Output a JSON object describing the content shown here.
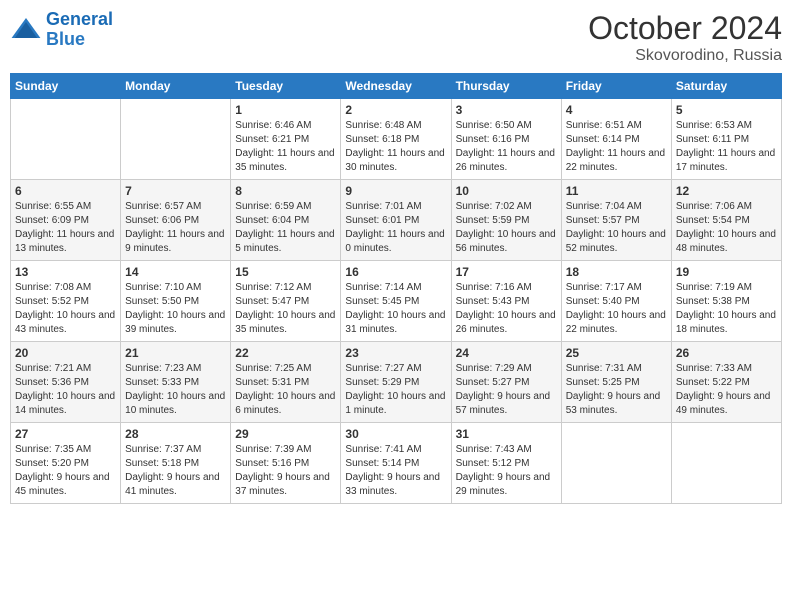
{
  "logo": {
    "line1": "General",
    "line2": "Blue"
  },
  "title": "October 2024",
  "location": "Skovorodino, Russia",
  "days_of_week": [
    "Sunday",
    "Monday",
    "Tuesday",
    "Wednesday",
    "Thursday",
    "Friday",
    "Saturday"
  ],
  "weeks": [
    [
      {
        "day": "",
        "sunrise": "",
        "sunset": "",
        "daylight": ""
      },
      {
        "day": "",
        "sunrise": "",
        "sunset": "",
        "daylight": ""
      },
      {
        "day": "1",
        "sunrise": "Sunrise: 6:46 AM",
        "sunset": "Sunset: 6:21 PM",
        "daylight": "Daylight: 11 hours and 35 minutes."
      },
      {
        "day": "2",
        "sunrise": "Sunrise: 6:48 AM",
        "sunset": "Sunset: 6:18 PM",
        "daylight": "Daylight: 11 hours and 30 minutes."
      },
      {
        "day": "3",
        "sunrise": "Sunrise: 6:50 AM",
        "sunset": "Sunset: 6:16 PM",
        "daylight": "Daylight: 11 hours and 26 minutes."
      },
      {
        "day": "4",
        "sunrise": "Sunrise: 6:51 AM",
        "sunset": "Sunset: 6:14 PM",
        "daylight": "Daylight: 11 hours and 22 minutes."
      },
      {
        "day": "5",
        "sunrise": "Sunrise: 6:53 AM",
        "sunset": "Sunset: 6:11 PM",
        "daylight": "Daylight: 11 hours and 17 minutes."
      }
    ],
    [
      {
        "day": "6",
        "sunrise": "Sunrise: 6:55 AM",
        "sunset": "Sunset: 6:09 PM",
        "daylight": "Daylight: 11 hours and 13 minutes."
      },
      {
        "day": "7",
        "sunrise": "Sunrise: 6:57 AM",
        "sunset": "Sunset: 6:06 PM",
        "daylight": "Daylight: 11 hours and 9 minutes."
      },
      {
        "day": "8",
        "sunrise": "Sunrise: 6:59 AM",
        "sunset": "Sunset: 6:04 PM",
        "daylight": "Daylight: 11 hours and 5 minutes."
      },
      {
        "day": "9",
        "sunrise": "Sunrise: 7:01 AM",
        "sunset": "Sunset: 6:01 PM",
        "daylight": "Daylight: 11 hours and 0 minutes."
      },
      {
        "day": "10",
        "sunrise": "Sunrise: 7:02 AM",
        "sunset": "Sunset: 5:59 PM",
        "daylight": "Daylight: 10 hours and 56 minutes."
      },
      {
        "day": "11",
        "sunrise": "Sunrise: 7:04 AM",
        "sunset": "Sunset: 5:57 PM",
        "daylight": "Daylight: 10 hours and 52 minutes."
      },
      {
        "day": "12",
        "sunrise": "Sunrise: 7:06 AM",
        "sunset": "Sunset: 5:54 PM",
        "daylight": "Daylight: 10 hours and 48 minutes."
      }
    ],
    [
      {
        "day": "13",
        "sunrise": "Sunrise: 7:08 AM",
        "sunset": "Sunset: 5:52 PM",
        "daylight": "Daylight: 10 hours and 43 minutes."
      },
      {
        "day": "14",
        "sunrise": "Sunrise: 7:10 AM",
        "sunset": "Sunset: 5:50 PM",
        "daylight": "Daylight: 10 hours and 39 minutes."
      },
      {
        "day": "15",
        "sunrise": "Sunrise: 7:12 AM",
        "sunset": "Sunset: 5:47 PM",
        "daylight": "Daylight: 10 hours and 35 minutes."
      },
      {
        "day": "16",
        "sunrise": "Sunrise: 7:14 AM",
        "sunset": "Sunset: 5:45 PM",
        "daylight": "Daylight: 10 hours and 31 minutes."
      },
      {
        "day": "17",
        "sunrise": "Sunrise: 7:16 AM",
        "sunset": "Sunset: 5:43 PM",
        "daylight": "Daylight: 10 hours and 26 minutes."
      },
      {
        "day": "18",
        "sunrise": "Sunrise: 7:17 AM",
        "sunset": "Sunset: 5:40 PM",
        "daylight": "Daylight: 10 hours and 22 minutes."
      },
      {
        "day": "19",
        "sunrise": "Sunrise: 7:19 AM",
        "sunset": "Sunset: 5:38 PM",
        "daylight": "Daylight: 10 hours and 18 minutes."
      }
    ],
    [
      {
        "day": "20",
        "sunrise": "Sunrise: 7:21 AM",
        "sunset": "Sunset: 5:36 PM",
        "daylight": "Daylight: 10 hours and 14 minutes."
      },
      {
        "day": "21",
        "sunrise": "Sunrise: 7:23 AM",
        "sunset": "Sunset: 5:33 PM",
        "daylight": "Daylight: 10 hours and 10 minutes."
      },
      {
        "day": "22",
        "sunrise": "Sunrise: 7:25 AM",
        "sunset": "Sunset: 5:31 PM",
        "daylight": "Daylight: 10 hours and 6 minutes."
      },
      {
        "day": "23",
        "sunrise": "Sunrise: 7:27 AM",
        "sunset": "Sunset: 5:29 PM",
        "daylight": "Daylight: 10 hours and 1 minute."
      },
      {
        "day": "24",
        "sunrise": "Sunrise: 7:29 AM",
        "sunset": "Sunset: 5:27 PM",
        "daylight": "Daylight: 9 hours and 57 minutes."
      },
      {
        "day": "25",
        "sunrise": "Sunrise: 7:31 AM",
        "sunset": "Sunset: 5:25 PM",
        "daylight": "Daylight: 9 hours and 53 minutes."
      },
      {
        "day": "26",
        "sunrise": "Sunrise: 7:33 AM",
        "sunset": "Sunset: 5:22 PM",
        "daylight": "Daylight: 9 hours and 49 minutes."
      }
    ],
    [
      {
        "day": "27",
        "sunrise": "Sunrise: 7:35 AM",
        "sunset": "Sunset: 5:20 PM",
        "daylight": "Daylight: 9 hours and 45 minutes."
      },
      {
        "day": "28",
        "sunrise": "Sunrise: 7:37 AM",
        "sunset": "Sunset: 5:18 PM",
        "daylight": "Daylight: 9 hours and 41 minutes."
      },
      {
        "day": "29",
        "sunrise": "Sunrise: 7:39 AM",
        "sunset": "Sunset: 5:16 PM",
        "daylight": "Daylight: 9 hours and 37 minutes."
      },
      {
        "day": "30",
        "sunrise": "Sunrise: 7:41 AM",
        "sunset": "Sunset: 5:14 PM",
        "daylight": "Daylight: 9 hours and 33 minutes."
      },
      {
        "day": "31",
        "sunrise": "Sunrise: 7:43 AM",
        "sunset": "Sunset: 5:12 PM",
        "daylight": "Daylight: 9 hours and 29 minutes."
      },
      {
        "day": "",
        "sunrise": "",
        "sunset": "",
        "daylight": ""
      },
      {
        "day": "",
        "sunrise": "",
        "sunset": "",
        "daylight": ""
      }
    ]
  ]
}
